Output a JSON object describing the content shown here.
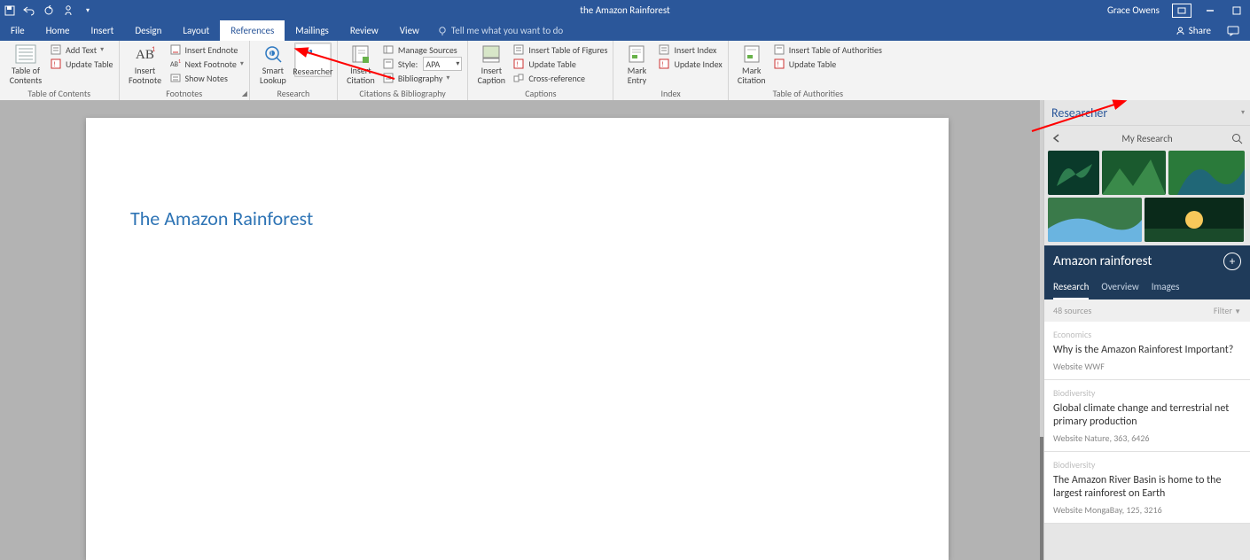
{
  "title": "the Amazon Rainforest",
  "user": "Grace Owens",
  "tabs": [
    "File",
    "Home",
    "Insert",
    "Design",
    "Layout",
    "References",
    "Mailings",
    "Review",
    "View"
  ],
  "active_tab_index": 5,
  "tell_me": "Tell me what you want to do",
  "share": "Share",
  "ribbon": {
    "toc": {
      "main": "Table of\nContents",
      "add_text": "Add Text",
      "update": "Update Table",
      "group": "Table of Contents"
    },
    "footnotes": {
      "main": "Insert\nFootnote",
      "endnote": "Insert Endnote",
      "next": "Next Footnote",
      "show": "Show Notes",
      "group": "Footnotes"
    },
    "research": {
      "smart": "Smart\nLookup",
      "researcher": "Researcher",
      "group": "Research"
    },
    "citations": {
      "insert": "Insert\nCitation",
      "manage": "Manage Sources",
      "style_lbl": "Style:",
      "style_val": "APA",
      "biblio": "Bibliography",
      "group": "Citations & Bibliography"
    },
    "captions": {
      "insert": "Insert\nCaption",
      "figures": "Insert Table of Figures",
      "update": "Update Table",
      "xref": "Cross-reference",
      "group": "Captions"
    },
    "index": {
      "mark": "Mark\nEntry",
      "insert": "Insert Index",
      "update": "Update Index",
      "group": "Index"
    },
    "toa": {
      "mark": "Mark\nCitation",
      "insert": "Insert Table of Authorities",
      "update": "Update Table",
      "group": "Table of Authorities"
    }
  },
  "document": {
    "heading": "The Amazon Rainforest"
  },
  "pane": {
    "title": "Researcher",
    "crumb": "My Research",
    "topic": "Amazon rainforest",
    "tabs": [
      "Research",
      "Overview",
      "Images"
    ],
    "active_tab": 0,
    "count": "48 sources",
    "filter": "Filter",
    "sources": [
      {
        "cat": "Economics",
        "title": "Why is the Amazon Rainforest Important?",
        "meta": "Website  WWF"
      },
      {
        "cat": "Biodiversity",
        "title": "Global climate change and terrestrial net primary production",
        "meta": "Website  Nature, 363, 6426"
      },
      {
        "cat": "Biodiversity",
        "title": "The Amazon River Basin is home to the largest rainforest on Earth",
        "meta": "Website  MongaBay, 125, 3216"
      }
    ]
  }
}
